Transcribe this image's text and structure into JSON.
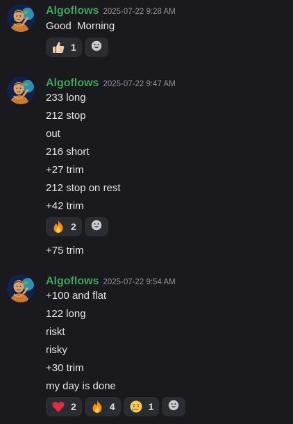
{
  "messages": [
    {
      "author": "Algoflows",
      "timestamp": "2025-07-22 9:28 AM",
      "lines": [
        "Good  Morning"
      ],
      "reactions": [
        {
          "emoji": "thumbs-up-icon",
          "count": "1"
        }
      ]
    },
    {
      "author": "Algoflows",
      "timestamp": "2025-07-22 9:47 AM",
      "lines": [
        "233 long",
        "212 stop",
        "out",
        "216 short",
        "+27 trim",
        "212 stop on rest",
        "+42 trim"
      ],
      "reactions": [
        {
          "emoji": "fire-icon",
          "count": "2"
        }
      ],
      "followup": "+75 trim"
    },
    {
      "author": "Algoflows",
      "timestamp": "2025-07-22 9:54 AM",
      "lines": [
        "+100 and flat",
        "122 long",
        "riskt",
        "risky",
        "+30 trim",
        "my day is done"
      ],
      "reactions": [
        {
          "emoji": "heart-icon",
          "count": "2"
        },
        {
          "emoji": "fire-icon",
          "count": "4"
        },
        {
          "emoji": "crying-face-icon",
          "count": "1"
        }
      ]
    }
  ],
  "colors": {
    "background": "#1a1a1e",
    "author": "#3ba55d",
    "text": "#e4e5e8",
    "timestamp": "#8f929a",
    "reaction_bg": "#2b2c32"
  }
}
